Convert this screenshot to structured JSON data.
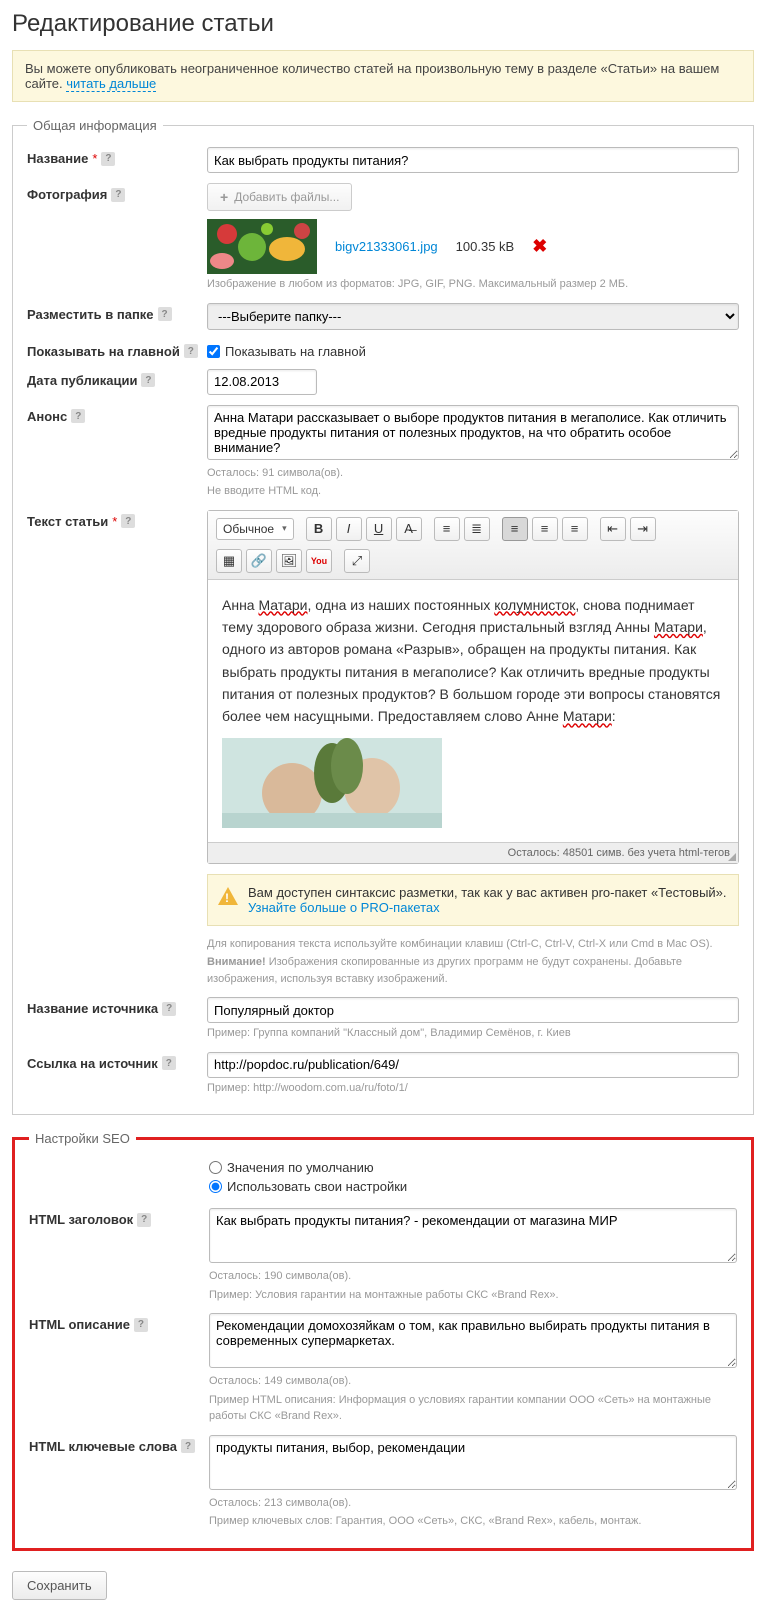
{
  "page_title": "Редактирование статьи",
  "notice_text": "Вы можете опубликовать неограниченное количество статей на произвольную тему в разделе «Статьи» на вашем сайте. ",
  "notice_link": "читать дальше",
  "fieldset_general_legend": "Общая информация",
  "fieldset_seo_legend": "Настройки SEO",
  "labels": {
    "name": "Название",
    "photo": "Фотография",
    "folder": "Разместить в папке",
    "show_home": "Показывать на главной",
    "date": "Дата публикации",
    "announce": "Анонс",
    "body": "Текст статьи",
    "source_name": "Название источника",
    "source_url": "Ссылка на источник",
    "html_title": "HTML заголовок",
    "html_desc": "HTML описание",
    "html_keywords": "HTML ключевые слова"
  },
  "add_files_label": "Добавить файлы...",
  "file": {
    "name": "bigv21333061.jpg",
    "size": "100.35 kB"
  },
  "photo_hint": "Изображение в любом из форматов: JPG, GIF, PNG. Максимальный размер 2 МБ.",
  "folder_select": "---Выберите папку---",
  "show_home_checkbox_label": "Показывать на главной",
  "date_value": "12.08.2013",
  "name_value": "Как выбрать продукты питания?",
  "announce_value": "Анна Матари рассказывает о выборе продуктов питания в мегаполисе. Как отличить вредные продукты питания от полезных продуктов, на что обратить особое внимание?",
  "announce_hint1": "Осталось: 91 символа(ов).",
  "announce_hint2": "Не вводите HTML код.",
  "editor_format_label": "Обычное",
  "editor_symbols": "Осталось: 48501 симв. без учета html-тегов",
  "body_text_before1": "Анна ",
  "body_w1": "Матари",
  "body_text_mid1": ", одна из наших постоянных ",
  "body_w2": "колумнисток",
  "body_text_mid2": ", снова поднимает тему здорового образа жизни. Сегодня пристальный взгляд Анны ",
  "body_w3": "Матари",
  "body_text_mid3": ", одного из авторов романа «Разрыв», обращен на продукты питания. Как выбрать продукты питания в мегаполисе? Как отличить вредные продукты питания от полезных продуктов? В большом городе эти вопросы становятся более чем насущными. Предоставляем слово Анне ",
  "body_w4": "Матари",
  "body_text_after": ":",
  "pro_alert_text": "Вам доступен синтаксис разметки, так как у вас активен pro-пакет «Тестовый». ",
  "pro_alert_link": "Узнайте больше о PRO-пакетах",
  "copy_hint1": "Для копирования текста используйте комбинации клавиш (Ctrl-C, Ctrl-V, Ctrl-X или Cmd в Mac OS).",
  "copy_hint2_strong": "Внимание!",
  "copy_hint2_rest": " Изображения скопированные из других программ не будут сохранены. Добавьте изображения, используя вставку изображений.",
  "source_name_value": "Популярный доктор",
  "source_name_hint": "Пример: Группа компаний \"Классный дом\", Владимир Семёнов, г. Киев",
  "source_url_value": "http://popdoc.ru/publication/649/",
  "source_url_hint": "Пример: http://woodom.com.ua/ru/foto/1/",
  "seo_radio_default": "Значения по умолчанию",
  "seo_radio_custom": "Использовать свои настройки",
  "html_title_value": "Как выбрать продукты питания? - рекомендации от магазина МИР",
  "html_title_hint1": "Осталось: 190 символа(ов).",
  "html_title_hint2": "Пример: Условия гарантии на монтажные работы СКС «Brand Rex».",
  "html_desc_value": "Рекомендации домохозяйкам о том, как правильно выбирать продукты питания в современных супермаркетах.",
  "html_desc_hint1": "Осталось: 149 символа(ов).",
  "html_desc_hint2": "Пример HTML описания: Информация о условиях гарантии компании ООО «Сеть» на монтажные работы СКС «Brand Rex».",
  "html_keywords_value": "продукты питания, выбор, рекомендации",
  "html_keywords_hint1": "Осталось: 213 символа(ов).",
  "html_keywords_hint2": "Пример ключевых слов: Гарантия, ООО «Сеть», СКС, «Brand Rex», кабель, монтаж.",
  "save_button": "Сохранить"
}
